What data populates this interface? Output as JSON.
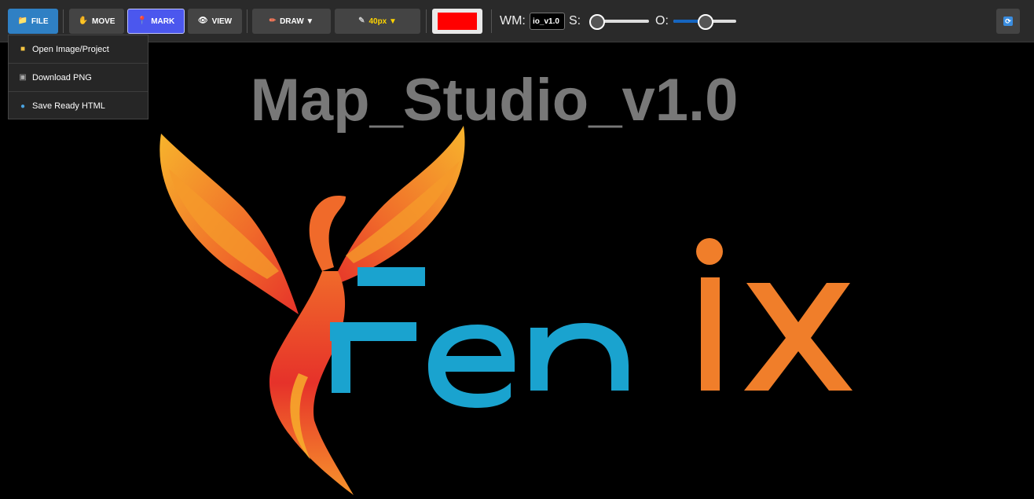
{
  "toolbar": {
    "file": {
      "label": "FILE",
      "icon": "folder-icon"
    },
    "move": {
      "label": "MOVE",
      "icon": "hand-icon"
    },
    "mark": {
      "label": "MARK",
      "icon": "pin-icon"
    },
    "view": {
      "label": "VIEW",
      "icon": "eye-icon"
    },
    "draw": {
      "label": "DRAW ▼",
      "icon": "pencil-icon"
    },
    "size": {
      "label": "40px ▼",
      "icon": "brush-icon"
    },
    "color": "#ff0000",
    "wm_label": "WM:",
    "wm_value": "io_v1.0",
    "s_label": "S:",
    "o_label": "O:",
    "s_value": 0.1,
    "o_value": 0.5,
    "refresh_icon": "refresh-icon"
  },
  "file_menu": {
    "items": [
      {
        "label": "Open Image/Project",
        "icon": "folder-icon"
      },
      {
        "label": "Download PNG",
        "icon": "camera-icon"
      },
      {
        "label": "Save Ready HTML",
        "icon": "globe-icon"
      }
    ]
  },
  "canvas": {
    "watermark": "Map_Studio_v1.0",
    "logo": {
      "text_letters": [
        "F",
        "e",
        "n",
        "i",
        "x"
      ],
      "colors": {
        "blue": "#1aa3cf",
        "orange": "#f07e2a",
        "phoenix_red": "#e6322a",
        "phoenix_yellow": "#f7b42c"
      }
    }
  }
}
